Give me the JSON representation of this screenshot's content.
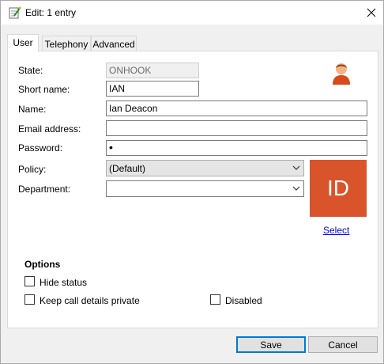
{
  "window": {
    "title": "Edit: 1 entry"
  },
  "tabs": [
    {
      "label": "User",
      "active": true
    },
    {
      "label": "Telephony",
      "active": false
    },
    {
      "label": "Advanced",
      "active": false
    }
  ],
  "form": {
    "state_label": "State:",
    "state_value": "ONHOOK",
    "short_name_label": "Short name:",
    "short_name_value": "IAN",
    "name_label": "Name:",
    "name_value": "Ian Deacon",
    "email_label": "Email address:",
    "email_value": "",
    "password_label": "Password:",
    "password_value": "•",
    "policy_label": "Policy:",
    "policy_value": "(Default)",
    "department_label": "Department:",
    "department_value": ""
  },
  "avatar": {
    "initials": "ID",
    "color": "#d9542b",
    "select_link": "Select"
  },
  "options": {
    "title": "Options",
    "hide_status": {
      "label": "Hide status",
      "checked": false
    },
    "keep_private": {
      "label": "Keep call details private",
      "checked": false
    },
    "disabled": {
      "label": "Disabled",
      "checked": false
    }
  },
  "buttons": {
    "save": "Save",
    "cancel": "Cancel"
  },
  "icons": {
    "title": "edit-notepad-icon",
    "user": "user-person-icon",
    "close": "close-icon"
  }
}
